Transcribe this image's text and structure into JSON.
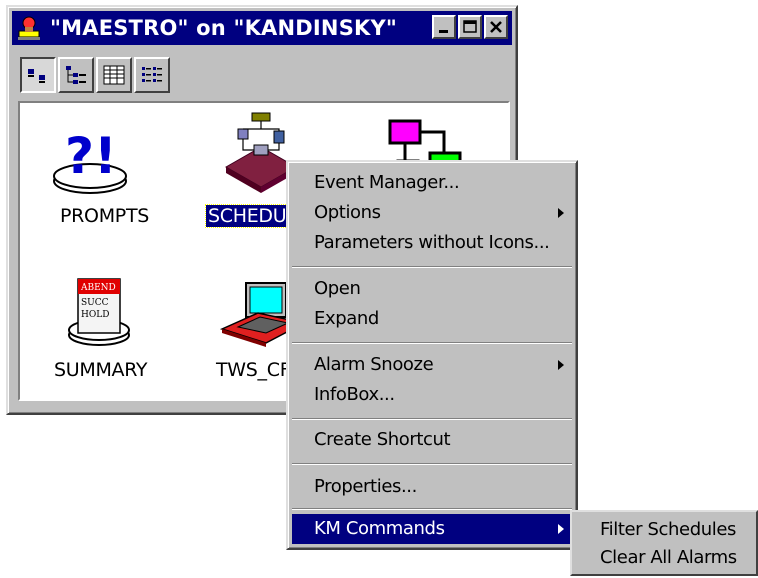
{
  "window": {
    "title": "\"MAESTRO\" on \"KANDINSKY\"",
    "controls": {
      "minimize": "minimize-icon",
      "maximize": "maximize-icon",
      "close": "close-icon"
    }
  },
  "toolbar": {
    "buttons": [
      {
        "icon": "large-icons-view-icon",
        "pressed": true
      },
      {
        "icon": "tree-view-icon",
        "pressed": false
      },
      {
        "icon": "details-view-icon",
        "pressed": false
      },
      {
        "icon": "list-view-icon",
        "pressed": false
      }
    ]
  },
  "icons": [
    {
      "label": "PROMPTS",
      "icon": "prompts-icon",
      "selected": false
    },
    {
      "label": "SCHEDUL",
      "icon": "schedules-icon",
      "selected": true
    },
    {
      "label": "",
      "icon": "workstation-tree-icon",
      "selected": false
    },
    {
      "label": "SUMMARY",
      "icon": "summary-icon",
      "selected": false,
      "badge": [
        "ABEND",
        "SUCC",
        "HOLD"
      ]
    },
    {
      "label": "TWS_CF",
      "icon": "laptop-icon",
      "selected": false
    }
  ],
  "context_menu": {
    "items": [
      {
        "label": "Event Manager...",
        "submenu": false
      },
      {
        "label": "Options",
        "submenu": true
      },
      {
        "label": "Parameters without Icons...",
        "submenu": false
      },
      {
        "label": "Open",
        "submenu": false
      },
      {
        "label": "Expand",
        "submenu": false
      },
      {
        "label": "Alarm Snooze",
        "submenu": true
      },
      {
        "label": "InfoBox...",
        "submenu": false
      },
      {
        "label": "Create Shortcut",
        "submenu": false
      },
      {
        "label": "Properties...",
        "submenu": false
      },
      {
        "label": "KM Commands",
        "submenu": true,
        "highlighted": true
      }
    ]
  },
  "submenu": {
    "items": [
      {
        "label": "Filter Schedules"
      },
      {
        "label": "Clear All Alarms"
      }
    ]
  },
  "colors": {
    "title_bar": "#000080",
    "highlight": "#000080",
    "face": "#c0c0c0"
  }
}
